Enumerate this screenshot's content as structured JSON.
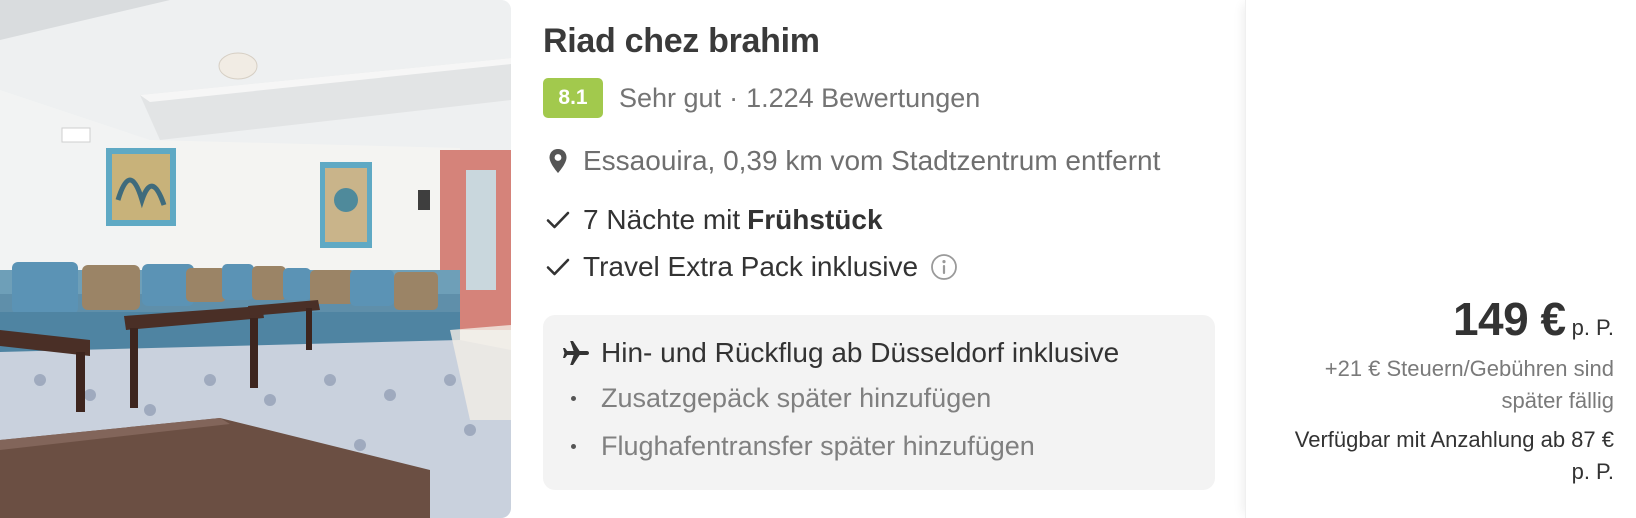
{
  "hotel": {
    "name": "Riad chez brahim",
    "photo_alt": "Lobby mit Sitzbänken",
    "rating": {
      "score": "8.1",
      "score_color": "#a2c94d",
      "label": "Sehr gut",
      "separator": "·",
      "reviews": "1.224 Bewertungen"
    },
    "location": {
      "icon": "location-pin-icon",
      "text": "Essaouira, 0,39 km vom Stadtzentrum entfernt"
    },
    "features": {
      "nights_prefix": "7 Nächte mit",
      "nights_board": "Frühstück",
      "extra_pack": "Travel Extra Pack inklusive",
      "check_icon": "checkmark-icon",
      "info_icon": "info-icon"
    },
    "flight": {
      "icon": "airplane-icon",
      "text": "Hin- und Rückflug ab Düsseldorf inklusive",
      "addons": [
        "Zusatzgepäck später hinzufügen",
        "Flughafentransfer später hinzufügen"
      ]
    }
  },
  "price": {
    "amount": "149 €",
    "unit": "p. P.",
    "fees": "+21 € Steuern/Gebühren sind später fällig",
    "deposit": "Verfügbar mit Anzahlung ab 87 € p. P."
  }
}
